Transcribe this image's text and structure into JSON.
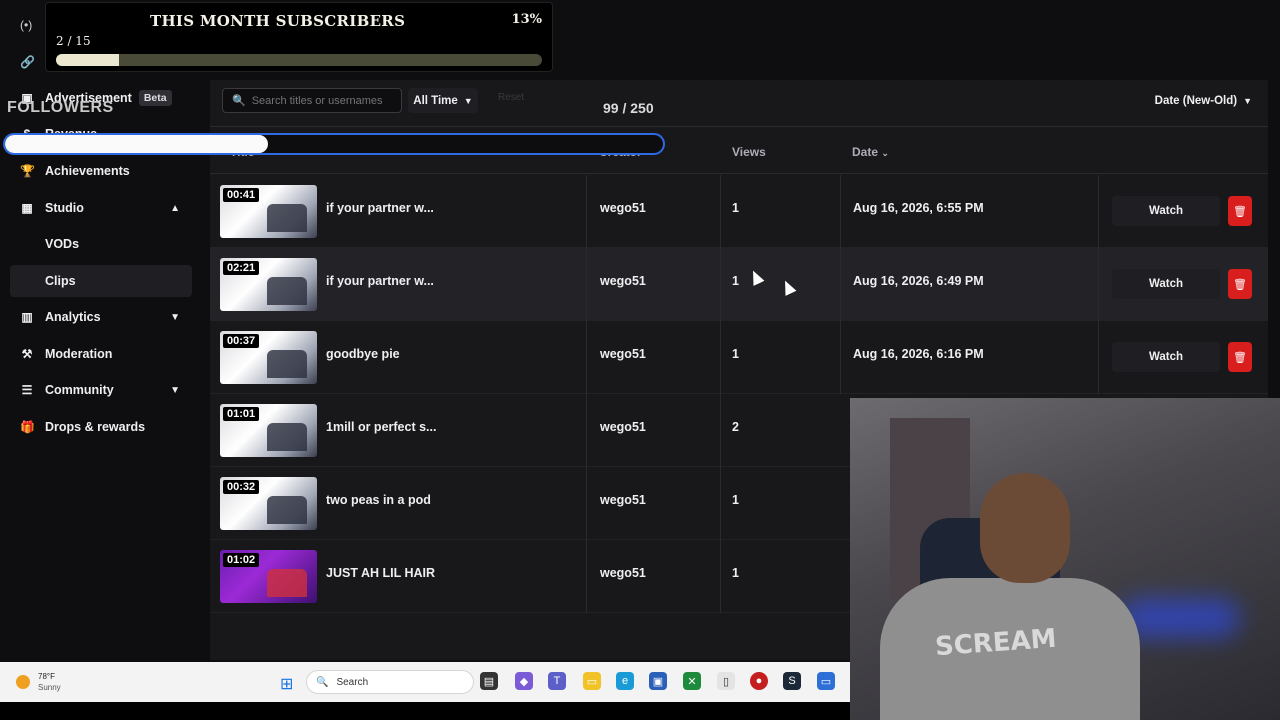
{
  "overlay": {
    "subscribers_title": "THIS MONTH SUBSCRIBERS",
    "subscribers_percent": "13%",
    "subscribers_count": "2 / 15",
    "subscribers_progress": 0.13,
    "followers_label": "FOLLOWERS",
    "followers_progress": 0.4
  },
  "sidebar": {
    "items": [
      {
        "label": "Advertisement",
        "icon": "ad-icon",
        "badge": "Beta"
      },
      {
        "label": "Revenue",
        "icon": "revenue-icon"
      },
      {
        "label": "Achievements",
        "icon": "trophy-icon"
      },
      {
        "label": "Studio",
        "icon": "studio-icon"
      },
      {
        "label": "VODs",
        "icon": ""
      },
      {
        "label": "Clips",
        "icon": ""
      },
      {
        "label": "Analytics",
        "icon": "chart-icon"
      },
      {
        "label": "Moderation",
        "icon": "hammer-icon"
      },
      {
        "label": "Community",
        "icon": "community-icon"
      },
      {
        "label": "Drops & rewards",
        "icon": "gift-icon"
      }
    ]
  },
  "toolbar": {
    "search_placeholder": "Search titles or usernames",
    "filter_label": "All Time",
    "reset_label": "Reset",
    "counter": "99 / 250",
    "sort_label": "Date (New-Old)"
  },
  "table": {
    "headers": {
      "title": "Title",
      "creator": "Creator",
      "views": "Views",
      "date": "Date"
    },
    "rows": [
      {
        "duration": "00:41",
        "title": "if your partner w...",
        "creator": "wego51",
        "views": "1",
        "date": "Aug 16, 2026, 6:55 PM",
        "watch": "Watch"
      },
      {
        "duration": "02:21",
        "title": "if your partner w...",
        "creator": "wego51",
        "views": "1",
        "date": "Aug 16, 2026, 6:49 PM",
        "watch": "Watch"
      },
      {
        "duration": "00:37",
        "title": "goodbye pie",
        "creator": "wego51",
        "views": "1",
        "date": "Aug 16, 2026, 6:16 PM",
        "watch": "Watch"
      },
      {
        "duration": "01:01",
        "title": "1mill or perfect s...",
        "creator": "wego51",
        "views": "2",
        "date": "",
        "watch": ""
      },
      {
        "duration": "00:32",
        "title": "two peas in a pod",
        "creator": "wego51",
        "views": "1",
        "date": "",
        "watch": ""
      },
      {
        "duration": "01:02",
        "title": "JUST AH LIL HAIR",
        "creator": "wego51",
        "views": "1",
        "date": "",
        "watch": ""
      }
    ]
  },
  "webcam": {
    "shirt_text": "SCREAM"
  },
  "taskbar": {
    "weather_temp": "78°F",
    "weather_desc": "Sunny",
    "search_label": "Search"
  },
  "colors": {
    "accent": "#2b6ae4",
    "delete": "#d91e1e"
  }
}
